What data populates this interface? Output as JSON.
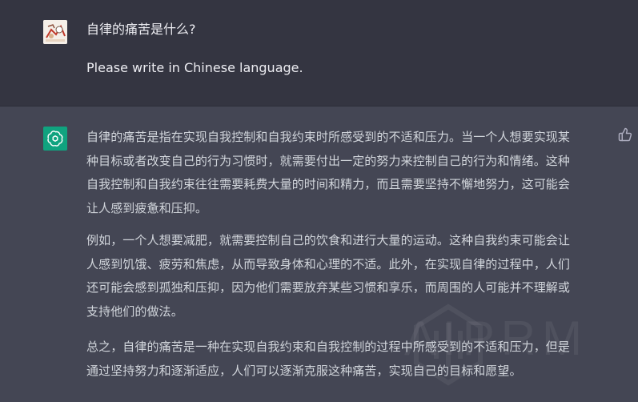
{
  "user_message": {
    "question": "自律的痛苦是什么?",
    "instruction": "Please write in Chinese language."
  },
  "assistant_message": {
    "paragraphs": [
      [
        "自律的痛苦是指在实现自我控制和自我约束时所感受到的不适和压力。当一个人想要实现某",
        "种目标或者改变自己的行为习惯时，就需要付出一定的努力来控制自己的行为和情绪。这种",
        "自我控制和自我约束往往需要耗费大量的时间和精力，而且需要坚持不懈地努力，这可能会",
        "让人感到疲惫和压抑。"
      ],
      [
        "例如，一个人想要减肥，就需要控制自己的饮食和进行大量的运动。这种自我约束可能会让",
        "人感到饥饿、疲劳和焦虑，从而导致身体和心理的不适。此外，在实现自律的过程中，人们",
        "还可能会感到孤独和压抑，因为他们需要放弃某些习惯和享乐，而周围的人可能并不理解或",
        "支持他们的做法。"
      ],
      [
        "总之，自律的痛苦是一种在实现自我约束和自我控制的过程中所感受到的不适和压力，但是",
        "通过坚持努力和逐渐适应，人们可以逐渐克服这种痛苦，实现自己的目标和愿望。"
      ]
    ]
  },
  "watermark": {
    "text": "AIPRM"
  },
  "icons": {
    "user_avatar": "user-avatar-icon",
    "assistant_avatar": "openai-logo-icon",
    "feedback": "thumbs-up-icon"
  },
  "colors": {
    "user_bg": "#343541",
    "assistant_bg": "#444654",
    "accent": "#10a37f",
    "text": "#d1d5db"
  }
}
